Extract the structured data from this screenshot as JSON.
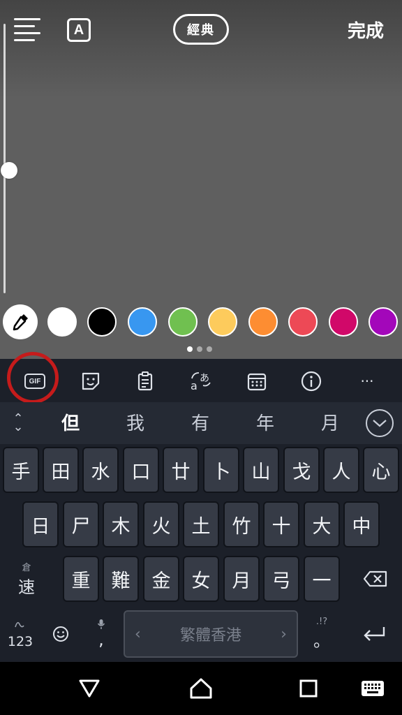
{
  "top_bar": {
    "text_style_label": "A",
    "font_style_label": "經典",
    "done_label": "完成"
  },
  "palette": {
    "colors": [
      "#ffffff",
      "#000000",
      "#3897f0",
      "#70c050",
      "#fdcb5c",
      "#fd8d32",
      "#ed4956",
      "#d10869",
      "#a307ba"
    ],
    "page_count": 3,
    "active_page": 1
  },
  "keyboard_toolbar": {
    "gif_label": "GIF",
    "more_label": "···"
  },
  "candidates": [
    "但",
    "我",
    "有",
    "年",
    "月"
  ],
  "keys": {
    "row1": [
      "手",
      "田",
      "水",
      "口",
      "廿",
      "卜",
      "山",
      "戈",
      "人",
      "心"
    ],
    "row2": [
      "日",
      "尸",
      "木",
      "火",
      "土",
      "竹",
      "十",
      "大",
      "中"
    ],
    "row3": [
      "重",
      "難",
      "金",
      "女",
      "月",
      "弓",
      "一"
    ],
    "mode_top": "倉",
    "mode_main": "速",
    "numbers_label": "123",
    "comma_label": ",",
    "space_label": "繁體香港",
    "punct_top": ".!?",
    "punct_main": "。"
  }
}
